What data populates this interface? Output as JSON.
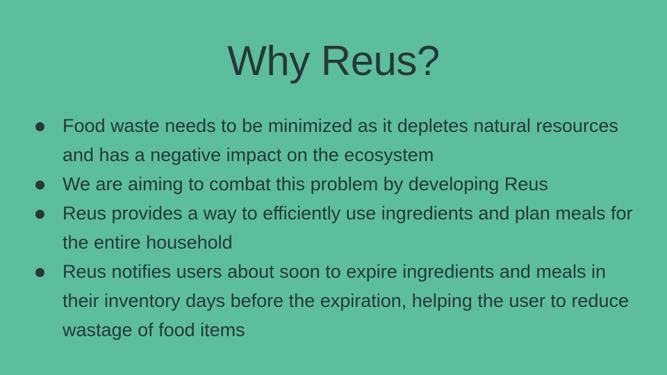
{
  "slide": {
    "title": "Why Reus?",
    "bullets": [
      "Food waste needs to be minimized as it depletes natural resources and has a negative impact on the ecosystem",
      "We are aiming to combat this problem by developing Reus",
      "Reus provides a way to efficiently use ingredients and plan meals for the entire household",
      "Reus notifies users about soon to expire ingredients and meals in their inventory days before the expiration, helping the user to reduce wastage of food items"
    ]
  },
  "colors": {
    "background": "#5dbe9e",
    "text": "#263838"
  }
}
